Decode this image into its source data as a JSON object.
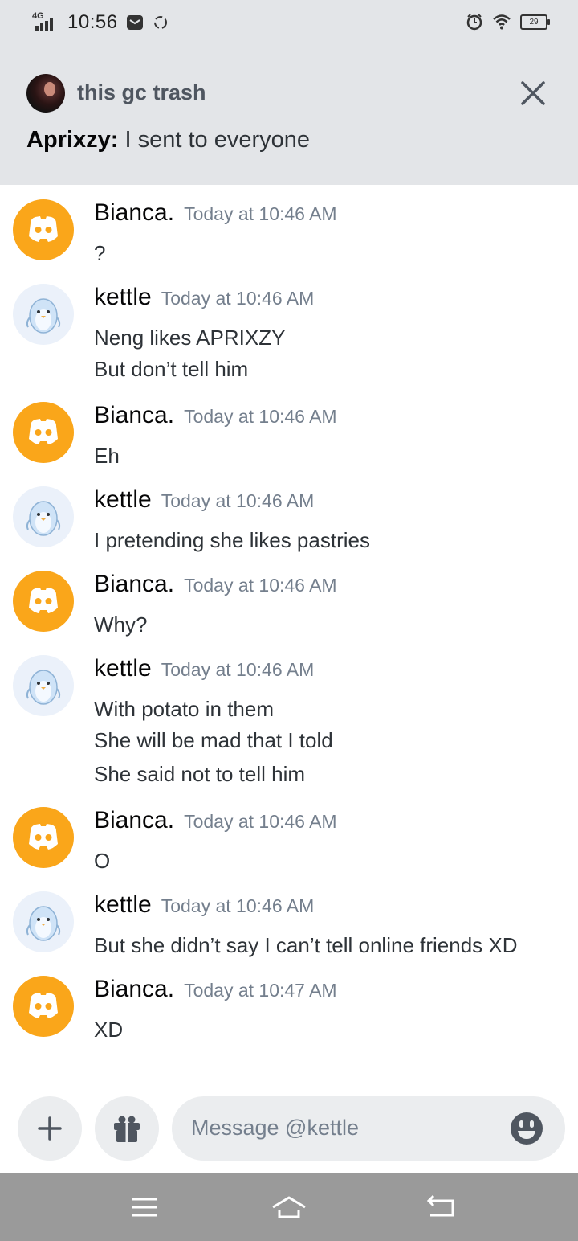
{
  "status_bar": {
    "network": "4G",
    "time": "10:56",
    "battery": "29"
  },
  "notification": {
    "title": "this gc trash",
    "author": "Aprixzy:",
    "text": "I sent to everyone"
  },
  "messages": [
    {
      "user": "Bianca.",
      "avatar": "discord-logo-icon",
      "time": "Today at 10:46 AM",
      "lines": [
        "?"
      ]
    },
    {
      "user": "kettle",
      "avatar": "penguin-avatar",
      "time": "Today at 10:46 AM",
      "lines": [
        "Neng likes APRIXZY",
        "But don’t tell him"
      ]
    },
    {
      "user": "Bianca.",
      "avatar": "discord-logo-icon",
      "time": "Today at 10:46 AM",
      "lines": [
        "Eh"
      ]
    },
    {
      "user": "kettle",
      "avatar": "penguin-avatar",
      "time": "Today at 10:46 AM",
      "lines": [
        "I pretending she likes pastries"
      ]
    },
    {
      "user": "Bianca.",
      "avatar": "discord-logo-icon",
      "time": "Today at 10:46 AM",
      "lines": [
        "Why?"
      ]
    },
    {
      "user": "kettle",
      "avatar": "penguin-avatar",
      "time": "Today at 10:46 AM",
      "lines": [
        "With potato in them",
        "She will be mad that I told",
        "She said not to tell him"
      ]
    },
    {
      "user": "Bianca.",
      "avatar": "discord-logo-icon",
      "time": "Today at 10:46 AM",
      "lines": [
        "O"
      ]
    },
    {
      "user": "kettle",
      "avatar": "penguin-avatar",
      "time": "Today at 10:46 AM",
      "lines": [
        "But she didn’t say I can’t tell online friends XD"
      ]
    },
    {
      "user": "Bianca.",
      "avatar": "discord-logo-icon",
      "time": "Today at 10:47 AM",
      "lines": [
        "XD"
      ]
    }
  ],
  "composer": {
    "placeholder": "Message @kettle"
  },
  "colors": {
    "discord_orange": "#faa61a",
    "header_bg": "#e3e5e8",
    "timestamp": "#747f8d"
  }
}
